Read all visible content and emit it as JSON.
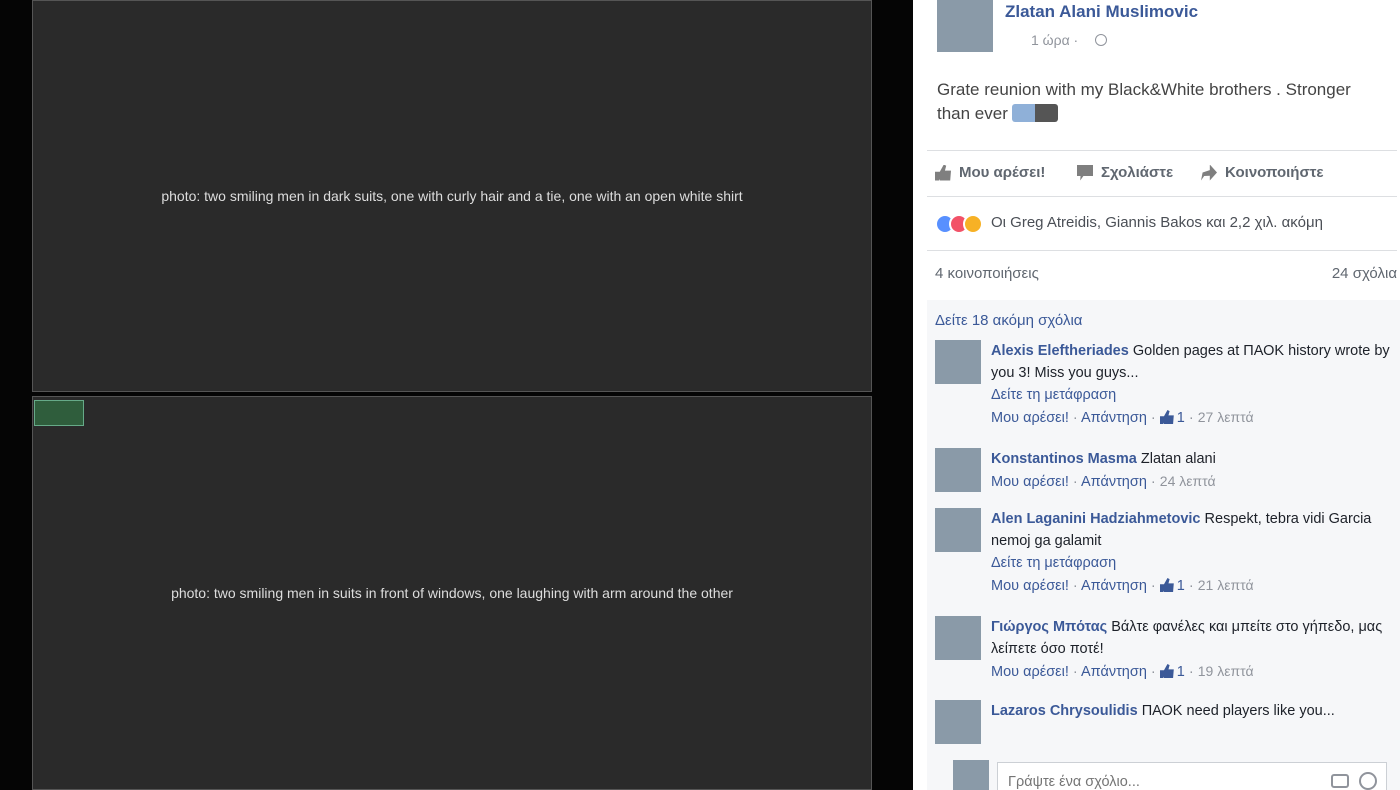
{
  "photos": {
    "top": "photo: two smiling men in dark suits, one with curly hair and a tie, one with an open white shirt",
    "bottom": "photo: two smiling men in suits in front of windows, one laughing with arm around the other",
    "badge": "badge"
  },
  "post": {
    "author": "Zlatan Alani Muslimovic",
    "time": "1 ώρα ·",
    "text": "Grate reunion with my Black&White brothers . Stronger than ever"
  },
  "actions": {
    "like": "Μου αρέσει!",
    "comment": "Σχολιάστε",
    "share": "Κοινοποιήστε"
  },
  "reactions": {
    "text": "Οι Greg Atreidis, Giannis Bakos και 2,2 χιλ. ακόμη"
  },
  "stats": {
    "shares": "4 κοινοποιήσεις",
    "comments": "24 σχόλια"
  },
  "more_comments": "Δείτε 18 ακόμη σχόλια",
  "comments": [
    {
      "name": "Alexis Eleftheriades",
      "text": "Golden pages at ΠΑΟΚ history wrote by you 3! Miss you guys...",
      "translate": "Δείτε τη μετάφραση",
      "like": "Μου αρέσει!",
      "reply": "Απάντηση",
      "likes": "1",
      "time": "27 λεπτά"
    },
    {
      "name": "Konstantinos Masma",
      "text": "Zlatan alani",
      "like": "Μου αρέσει!",
      "reply": "Απάντηση",
      "time": "24 λεπτά"
    },
    {
      "name": "Alen Laganini Hadziahmetovic",
      "text": "Respekt, tebra vidi Garcia nemoj ga galamit",
      "translate": "Δείτε τη μετάφραση",
      "like": "Μου αρέσει!",
      "reply": "Απάντηση",
      "likes": "1",
      "time": "21 λεπτά"
    },
    {
      "name": "Γιώργος Μπότας",
      "text": "Βάλτε φανέλες και μπείτε στο γήπεδο, μας λείπετε όσο ποτέ!",
      "like": "Μου αρέσει!",
      "reply": "Απάντηση",
      "likes": "1",
      "time": "19 λεπτά"
    },
    {
      "name": "Lazaros Chrysoulidis",
      "text": "ΠΑΟΚ need players like you..."
    }
  ],
  "write_comment": {
    "placeholder": "Γράψτε ένα σχόλιο..."
  }
}
